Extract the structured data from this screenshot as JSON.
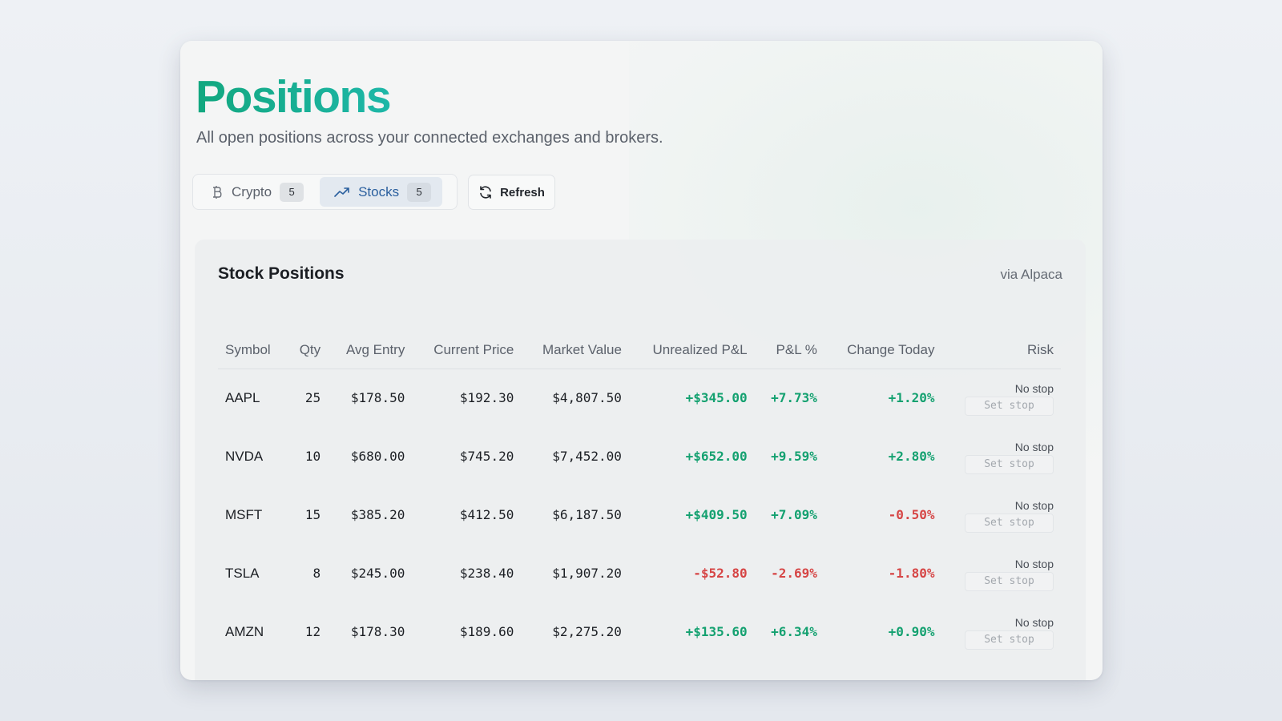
{
  "header": {
    "title": "Positions",
    "subtitle": "All open positions across your connected exchanges and brokers."
  },
  "tabs": [
    {
      "label": "Crypto",
      "count": "5",
      "icon": "bitcoin-icon",
      "active": false
    },
    {
      "label": "Stocks",
      "count": "5",
      "icon": "trending-up-icon",
      "active": true
    }
  ],
  "refresh": {
    "label": "Refresh",
    "icon": "refresh-icon"
  },
  "panel": {
    "title": "Stock Positions",
    "source": "via Alpaca",
    "columns": [
      "Symbol",
      "Qty",
      "Avg Entry",
      "Current Price",
      "Market Value",
      "Unrealized P&L",
      "P&L %",
      "Change Today",
      "Risk"
    ],
    "rows": [
      {
        "symbol": "AAPL",
        "qty": "25",
        "avg_entry": "$178.50",
        "current_price": "$192.30",
        "market_value": "$4,807.50",
        "unrealized_pl": "+$345.00",
        "pl_pct": "+7.73%",
        "change_today": "+1.20%",
        "risk_status": "No stop",
        "stop_placeholder": "Set stop"
      },
      {
        "symbol": "NVDA",
        "qty": "10",
        "avg_entry": "$680.00",
        "current_price": "$745.20",
        "market_value": "$7,452.00",
        "unrealized_pl": "+$652.00",
        "pl_pct": "+9.59%",
        "change_today": "+2.80%",
        "risk_status": "No stop",
        "stop_placeholder": "Set stop"
      },
      {
        "symbol": "MSFT",
        "qty": "15",
        "avg_entry": "$385.20",
        "current_price": "$412.50",
        "market_value": "$6,187.50",
        "unrealized_pl": "+$409.50",
        "pl_pct": "+7.09%",
        "change_today": "-0.50%",
        "risk_status": "No stop",
        "stop_placeholder": "Set stop"
      },
      {
        "symbol": "TSLA",
        "qty": "8",
        "avg_entry": "$245.00",
        "current_price": "$238.40",
        "market_value": "$1,907.20",
        "unrealized_pl": "-$52.80",
        "pl_pct": "-2.69%",
        "change_today": "-1.80%",
        "risk_status": "No stop",
        "stop_placeholder": "Set stop"
      },
      {
        "symbol": "AMZN",
        "qty": "12",
        "avg_entry": "$178.30",
        "current_price": "$189.60",
        "market_value": "$2,275.20",
        "unrealized_pl": "+$135.60",
        "pl_pct": "+6.34%",
        "change_today": "+0.90%",
        "risk_status": "No stop",
        "stop_placeholder": "Set stop"
      }
    ]
  },
  "colors": {
    "positive": "#14a170",
    "negative": "#d64545",
    "accent": "#2a5f9e",
    "title_gradient_start": "#12a77f",
    "title_gradient_end": "#1eb7a8"
  }
}
